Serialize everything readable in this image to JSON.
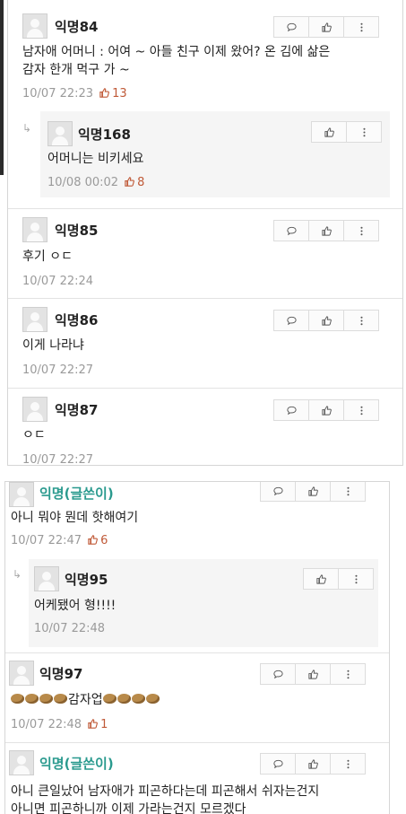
{
  "comments": [
    {
      "name": "익명84",
      "lines": [
        "남자애 어머니 : 어여 ~ 아들 친구 이제 왔어? 온 김에 삶은",
        "감자 한개 먹구 가 ~"
      ],
      "time": "10/07 22:23",
      "likes": "13"
    },
    {
      "name": "익명168",
      "lines": [
        "어머니는 비키세요"
      ],
      "time": "10/08 00:02",
      "likes": "8"
    },
    {
      "name": "익명85",
      "lines": [
        "후기 ㅇㄷ"
      ],
      "time": "10/07 22:24",
      "likes": ""
    },
    {
      "name": "익명86",
      "lines": [
        "이게 나라냐"
      ],
      "time": "10/07 22:27",
      "likes": ""
    },
    {
      "name": "익명87",
      "lines": [
        "ㅇㄷ"
      ],
      "time": "10/07 22:27",
      "likes": ""
    },
    {
      "name": "익명(글쓴이)",
      "lines": [
        "아니 뭐야 뭔데 핫해여기"
      ],
      "time": "10/07 22:47",
      "likes": "6"
    },
    {
      "name": "익명95",
      "lines": [
        "어케됐어 형!!!!"
      ],
      "time": "10/07 22:48",
      "likes": ""
    },
    {
      "name": "익명97",
      "text_mid": "감자업",
      "time": "10/07 22:48",
      "likes": "1"
    },
    {
      "name": "익명(글쓴이)",
      "lines": [
        "아니 큰일났어 남자애가 피곤하다는데 피곤해서 쉬자는건지",
        "아니면 피곤하니까 이제 가라는건지 모르겠다"
      ],
      "time": "",
      "likes": ""
    }
  ],
  "icons": {
    "comment": "speech-bubble-icon",
    "like": "thumbs-up-icon",
    "more": "more-vertical-icon",
    "reply": "reply-arrow-icon"
  },
  "colors": {
    "likes": "#c05a38",
    "author": "#2a9a8e",
    "meta": "#9a9a9a"
  }
}
